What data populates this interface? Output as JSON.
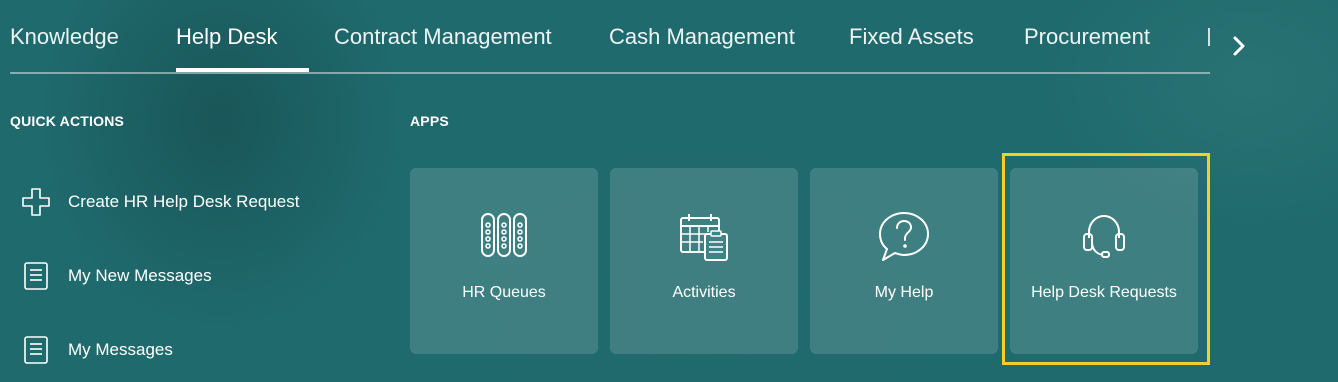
{
  "tabs": [
    {
      "label": "Knowledge"
    },
    {
      "label": "Help Desk",
      "active": true
    },
    {
      "label": "Contract Management"
    },
    {
      "label": "Cash Management"
    },
    {
      "label": "Fixed Assets"
    },
    {
      "label": "Procurement"
    }
  ],
  "quick_actions": {
    "title": "QUICK ACTIONS",
    "items": [
      {
        "label": "Create HR Help Desk Request",
        "icon": "plus-icon"
      },
      {
        "label": "My New Messages",
        "icon": "document-icon"
      },
      {
        "label": "My Messages",
        "icon": "document-icon"
      }
    ]
  },
  "apps": {
    "title": "APPS",
    "tiles": [
      {
        "label": "HR Queues",
        "icon": "queues-icon"
      },
      {
        "label": "Activities",
        "icon": "calendar-icon"
      },
      {
        "label": "My Help",
        "icon": "question-bubble-icon"
      },
      {
        "label": "Help Desk Requests",
        "icon": "headset-icon",
        "highlighted": true
      }
    ]
  },
  "colors": {
    "background": "#1f6a6d",
    "highlight": "#f4cf2c"
  }
}
